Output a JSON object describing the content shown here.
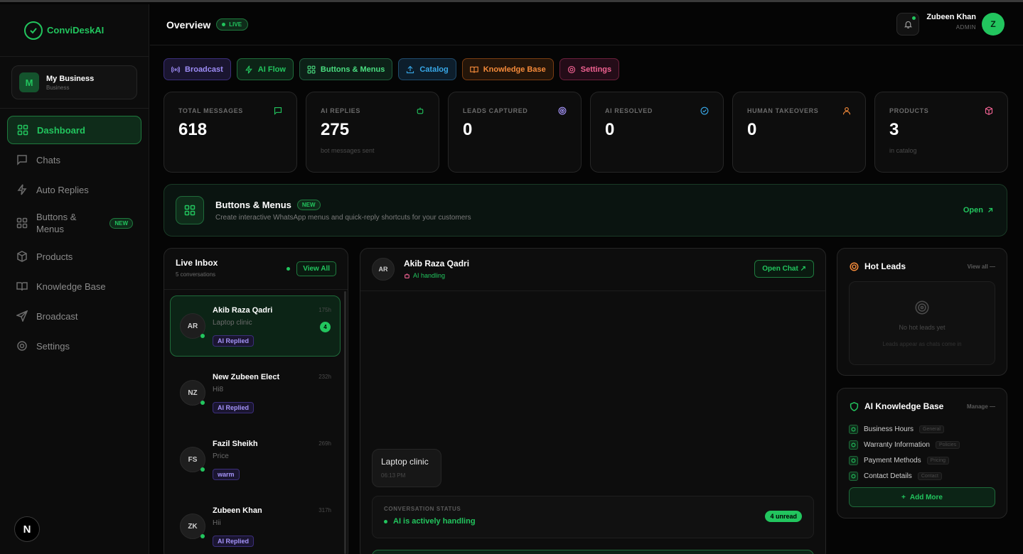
{
  "brand": {
    "name": "ConviDesk",
    "suffix": "AI"
  },
  "business": {
    "initial": "M",
    "name": "My Business",
    "type": "Business"
  },
  "nav": [
    {
      "label": "Dashboard",
      "icon": "grid-icon",
      "active": true
    },
    {
      "label": "Chats",
      "icon": "chat-icon"
    },
    {
      "label": "Auto Replies",
      "icon": "bolt-icon"
    },
    {
      "label": "Buttons & Menus",
      "icon": "grid-icon",
      "badge": "NEW"
    },
    {
      "label": "Products",
      "icon": "box-icon"
    },
    {
      "label": "Knowledge Base",
      "icon": "book-icon"
    },
    {
      "label": "Broadcast",
      "icon": "send-icon"
    },
    {
      "label": "Settings",
      "icon": "gear-icon"
    }
  ],
  "footer_button": "N",
  "header": {
    "title": "Overview",
    "live": "LIVE"
  },
  "user": {
    "name": "Zubeen Khan",
    "role": "ADMIN",
    "initial": "Z"
  },
  "quick_actions": [
    {
      "label": "Broadcast",
      "icon": "broadcast-icon",
      "color": "#9d8cf5"
    },
    {
      "label": "AI Flow",
      "icon": "bolt-icon",
      "color": "#22c55e"
    },
    {
      "label": "Buttons & Menus",
      "icon": "grid-icon",
      "color": "#4ade80"
    },
    {
      "label": "Catalog",
      "icon": "upload-icon",
      "color": "#38a8e8"
    },
    {
      "label": "Knowledge Base",
      "icon": "book-icon",
      "color": "#f58b3a"
    },
    {
      "label": "Settings",
      "icon": "gear-icon",
      "color": "#f06292"
    }
  ],
  "stats": [
    {
      "label": "TOTAL MESSAGES",
      "value": "618",
      "sub": "",
      "icon": "chat-icon",
      "color": "#22c55e"
    },
    {
      "label": "AI REPLIES",
      "value": "275",
      "sub": "bot messages sent",
      "icon": "bot-icon",
      "color": "#22c55e"
    },
    {
      "label": "LEADS CAPTURED",
      "value": "0",
      "sub": "",
      "icon": "target-icon",
      "color": "#a594f9"
    },
    {
      "label": "AI RESOLVED",
      "value": "0",
      "sub": "",
      "icon": "check-circle-icon",
      "color": "#38a8e8"
    },
    {
      "label": "HUMAN TAKEOVERS",
      "value": "0",
      "sub": "",
      "icon": "user-icon",
      "color": "#f58b3a"
    },
    {
      "label": "PRODUCTS",
      "value": "3",
      "sub": "in catalog",
      "icon": "box-icon",
      "color": "#f06292"
    }
  ],
  "feature": {
    "title": "Buttons & Menus",
    "badge": "NEW",
    "description": "Create interactive WhatsApp menus and quick-reply shortcuts for your customers",
    "action": "Open"
  },
  "inbox": {
    "title": "Live Inbox",
    "subtitle": "5 conversations",
    "view_all": "View All",
    "conversations": [
      {
        "initials": "AR",
        "name": "Akib Raza Qadri",
        "time": "175h",
        "message": "Laptop clinic",
        "tag": "AI Replied",
        "unread": "4",
        "active": true
      },
      {
        "initials": "NZ",
        "name": "New Zubeen Elect",
        "time": "232h",
        "message": "Hi8",
        "tag": "AI Replied"
      },
      {
        "initials": "FS",
        "name": "Fazil Sheikh",
        "time": "269h",
        "message": "Price",
        "tag": "warm"
      },
      {
        "initials": "ZK",
        "name": "Zubeen Khan",
        "time": "317h",
        "message": "Hii",
        "tag": "AI Replied"
      }
    ]
  },
  "chat": {
    "initials": "AR",
    "name": "Akib Raza Qadri",
    "status": "AI handling",
    "open_chat": "Open Chat",
    "message": {
      "text": "Laptop clinic",
      "time": "06:13 PM"
    },
    "conversation_status": {
      "label": "CONVERSATION STATUS",
      "value": "AI is actively handling",
      "unread": "4 unread"
    }
  },
  "hot_leads": {
    "title": "Hot Leads",
    "link": "View all —",
    "empty_title": "No hot leads yet",
    "empty_sub": "Leads appear as chats come in"
  },
  "knowledge_base": {
    "title": "AI Knowledge Base",
    "link": "Manage —",
    "items": [
      {
        "name": "Business Hours",
        "tag": "General"
      },
      {
        "name": "Warranty Information",
        "tag": "Policies"
      },
      {
        "name": "Payment Methods",
        "tag": "Pricing"
      },
      {
        "name": "Contact Details",
        "tag": "Contact"
      }
    ],
    "add_more": "Add More"
  }
}
